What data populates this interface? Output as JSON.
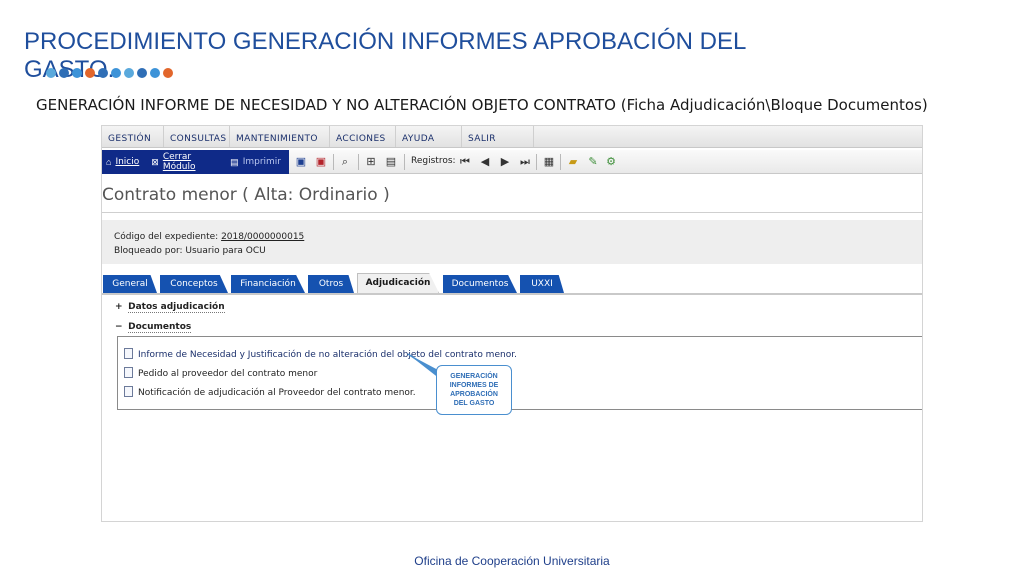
{
  "slide": {
    "title": "PROCEDIMIENTO GENERACIÓN INFORMES APROBACIÓN DEL GASTO.",
    "subtitle": "GENERACIÓN INFORME DE NECESIDAD Y NO ALTERACIÓN OBJETO CONTRATO (Ficha Adjudicación\\Bloque Documentos)",
    "footer": "Oficina de Cooperación Universitaria",
    "dot_colors": [
      "#5aa9dc",
      "#2f6eb6",
      "#3d93d8",
      "#e2662b",
      "#2f6eb6",
      "#3d93d8",
      "#5aa9dc",
      "#2f6eb6",
      "#3d93d8",
      "#e2662b"
    ]
  },
  "menubar": {
    "items": [
      "GESTIÓN",
      "CONSULTAS",
      "MANTENIMIENTO",
      "ACCIONES",
      "AYUDA",
      "SALIR"
    ]
  },
  "toolbar": {
    "inicio": "Inicio",
    "cerrar_modulo": "Cerrar Módulo",
    "imprimir": "Imprimir",
    "registros_label": "Registros:"
  },
  "form": {
    "title": "Contrato menor ( Alta: Ordinario )",
    "expediente_label": "Código del expediente:",
    "expediente_value": "2018/0000000015",
    "bloqueado_label": "Bloqueado por:",
    "bloqueado_value": "Usuario para OCU"
  },
  "tabs": [
    {
      "label": "General",
      "active": false
    },
    {
      "label": "Conceptos",
      "active": false
    },
    {
      "label": "Financiación",
      "active": false
    },
    {
      "label": "Otros",
      "active": false
    },
    {
      "label": "Adjudicación",
      "active": true
    },
    {
      "label": "Documentos",
      "active": false
    },
    {
      "label": "UXXI",
      "active": false
    }
  ],
  "sections": {
    "datos_adjudicacion": {
      "sign": "+",
      "label": "Datos adjudicación"
    },
    "documentos": {
      "sign": "−",
      "label": "Documentos"
    }
  },
  "documents": [
    "Informe de Necesidad y Justificación de no alteración del objeto del contrato menor.",
    "Pedido al proveedor del contrato menor",
    "Notificación de adjudicación al Proveedor del contrato menor."
  ],
  "callout": {
    "lines": [
      "GENERACIÓN",
      "INFORMES DE",
      "APROBACIÓN",
      "DEL GASTO"
    ],
    "color": "#2f6eb6"
  }
}
